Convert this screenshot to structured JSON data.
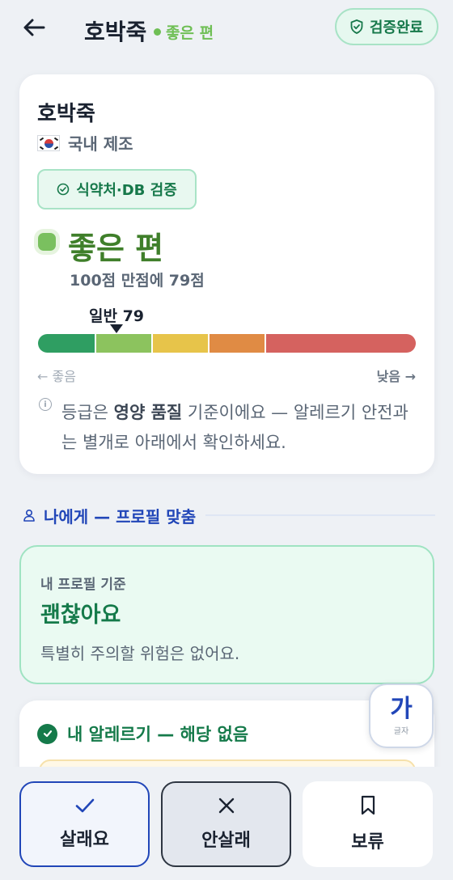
{
  "header": {
    "title": "호박죽",
    "grade": "좋은 편",
    "verified_label": "검증완료"
  },
  "summary": {
    "product_name": "호박죽",
    "origin": "국내 제조",
    "db_badge": "식약처·DB 검증",
    "grade": "좋은 편",
    "score_text": "100점 만점에 79점",
    "marker_label": "일반 79",
    "score": 79,
    "bar_left_label": "← 좋음",
    "bar_right_label": "낮음 →",
    "note_prefix": "등급은 ",
    "note_bold": "영양 품질",
    "note_suffix": " 기준이에요 — 알레르기 안전과는 별개로 아래에서 확인하세요.",
    "bar_colors": [
      "#2f9e62",
      "#8cc35e",
      "#e7c44a",
      "#e08b44",
      "#d5625f"
    ]
  },
  "profile_section": {
    "title": "나에게 — 프로필 맞춤",
    "kicker": "내 프로필 기준",
    "verdict": "괜찮아요",
    "description": "특별히 주의할 위험은 없어요."
  },
  "allergy": {
    "title": "내 알레르기 — 해당 없음"
  },
  "font_fab": {
    "big": "가",
    "small": "글자"
  },
  "actions": {
    "buy": "살래요",
    "nobuy": "안살래",
    "hold": "보류"
  },
  "colors": {
    "primary": "#2146b8",
    "good_green": "#157a4a",
    "grade_green": "#3f7f2a"
  }
}
